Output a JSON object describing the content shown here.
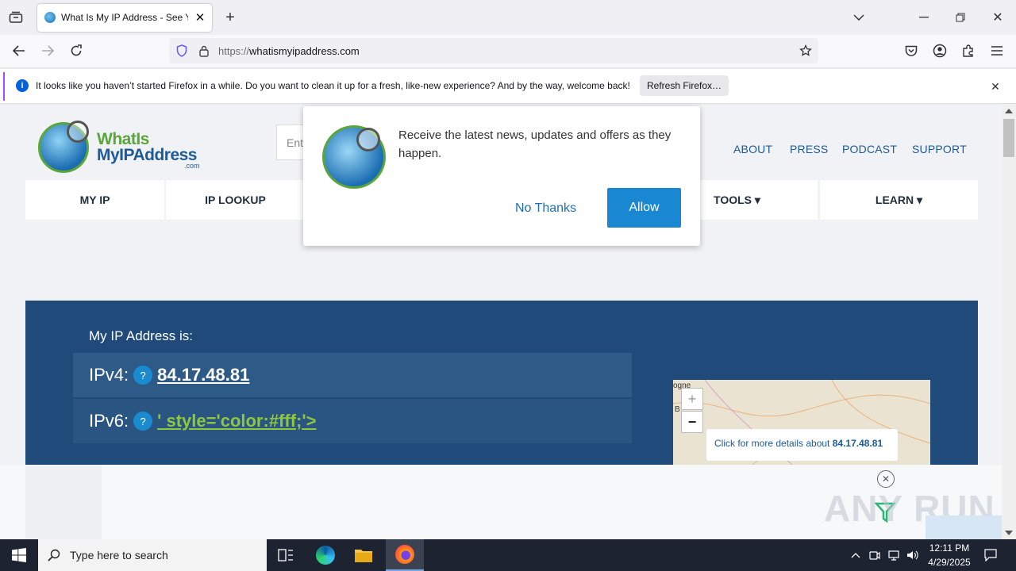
{
  "browser": {
    "tab_title": "What Is My IP Address - See Your",
    "url_scheme": "https://",
    "url_host": "whatismyipaddress.com"
  },
  "notification": {
    "message": "It looks like you haven’t started Firefox in a while. Do you want to clean it up for a fresh, like-new experience? And by the way, welcome back!",
    "button": "Refresh Firefox…"
  },
  "site": {
    "logo_line1": "WhatIs",
    "logo_line2": "MyIPAddress",
    "logo_line3": ".com",
    "search_placeholder": "Ent",
    "top_links": [
      "ABOUT",
      "PRESS",
      "PODCAST",
      "SUPPORT"
    ],
    "nav": [
      "MY IP",
      "IP LOOKUP",
      "TOOLS ▾",
      "LEARN ▾"
    ],
    "ip_heading": "My IP Address is:",
    "ipv4_label": "IPv4:",
    "ipv4_value": "84.17.48.81",
    "ipv6_label": "IPv6:",
    "ipv6_value": "' style='color:#fff;'>",
    "help": "?",
    "map_tooltip_prefix": "Click for more details about ",
    "map_tooltip_ip": "84.17.48.81",
    "map_text_top": "ogne",
    "map_text_side": "B",
    "zoom_in": "+",
    "zoom_out": "−"
  },
  "popup": {
    "message": "Receive the latest news, updates and offers as they happen.",
    "no_thanks": "No Thanks",
    "allow": "Allow"
  },
  "watermark": "ANY RUN",
  "taskbar": {
    "search_placeholder": "Type here to search",
    "time": "12:11 PM",
    "date": "4/29/2025"
  },
  "colors": {
    "accent": "#1a8bd0",
    "blue_panel": "#1f4a79",
    "allow_button": "#1a87d3",
    "ipv6_link": "#8dc63f"
  }
}
